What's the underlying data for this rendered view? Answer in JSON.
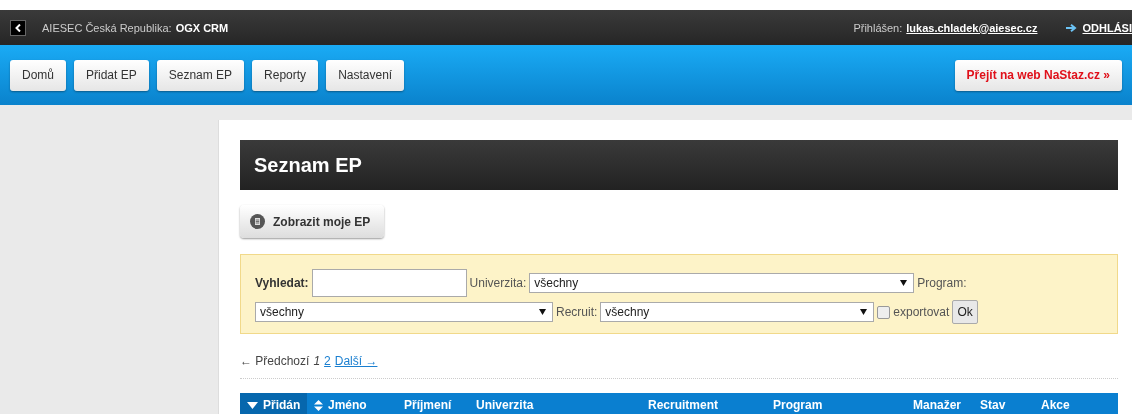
{
  "topbar": {
    "org": "AIESEC Česká Republika:",
    "app": "OGX CRM",
    "login_label": "Přihlášen:",
    "user": "lukas.chladek@aiesec.cz",
    "logout": "ODHLÁSI"
  },
  "nav": {
    "items": [
      "Domů",
      "Přidat EP",
      "Seznam EP",
      "Reporty",
      "Nastavení"
    ],
    "external": "Přejít na web NaStaz.cz »"
  },
  "page": {
    "title": "Seznam EP",
    "my_button": "Zobrazit moje EP"
  },
  "filter": {
    "search_label": "Vyhledat:",
    "university_label": "Univerzita:",
    "university_value": "všechny",
    "program_label": "Program:",
    "program_value": "všechny",
    "recruit_label": "Recruit:",
    "recruit_value": "všechny",
    "export_label": "exportovat",
    "export_checked": false,
    "ok": "Ok"
  },
  "pagination": {
    "prev": "← Předchozí",
    "pages": [
      {
        "label": "1",
        "selected": true
      },
      {
        "label": "2",
        "selected": false
      }
    ],
    "next": "Další →"
  },
  "table": {
    "columns": [
      {
        "label": "Přidán",
        "kind": "descending",
        "selected": true
      },
      {
        "label": "Jméno",
        "kind": "sortable",
        "selected": false
      },
      {
        "label": "Příjmení",
        "kind": "plain",
        "selected": false
      },
      {
        "label": "Univerzita",
        "kind": "plain",
        "selected": false
      },
      {
        "label": "Recruitment",
        "kind": "plain",
        "selected": false
      },
      {
        "label": "Program",
        "kind": "plain",
        "selected": false
      },
      {
        "label": "Manažer",
        "kind": "plain",
        "selected": false
      },
      {
        "label": "Stav",
        "kind": "plain",
        "selected": false
      },
      {
        "label": "Akce",
        "kind": "plain",
        "selected": false
      }
    ]
  }
}
